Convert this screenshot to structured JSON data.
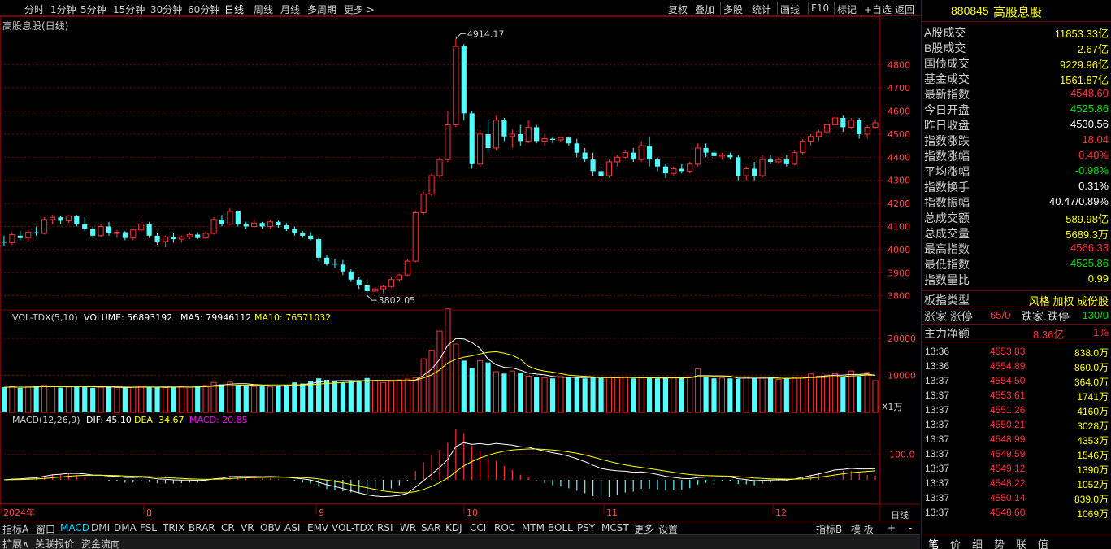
{
  "topbar": {
    "periods": [
      "分时",
      "1分钟",
      "5分钟",
      "15分钟",
      "30分钟",
      "60分钟",
      "日线",
      "周线",
      "月线",
      "多周期",
      "更多 >"
    ],
    "active_period": "日线",
    "tools": [
      "复权",
      "叠加",
      "多股",
      "统计",
      "画线",
      "F10",
      "标记",
      "+自选",
      "返回"
    ]
  },
  "chart": {
    "title": "高股息股(日线)",
    "max_label": "4914.17",
    "min_label": "3802.05",
    "price_axis": [
      "4800",
      "4700",
      "4600",
      "4500",
      "4400",
      "4300",
      "4200",
      "4100",
      "4000",
      "3900",
      "3800"
    ],
    "vol_header": {
      "name": "VOL-TDX(5,10)",
      "volume": "VOLUME: 56893192",
      "ma5": "MA5: 79946112",
      "ma10": "MA10: 76571032"
    },
    "vol_axis": [
      "20000",
      "10000"
    ],
    "vol_unit": "X1万",
    "macd_header": {
      "name": "MACD(12,26,9)",
      "dif": "DIF: 45.10",
      "dea": "DEA: 34.67",
      "macd": "MACD: 20.85"
    },
    "macd_axis": [
      "100.0"
    ],
    "date_labels": [
      "2024年",
      "8",
      "9",
      "10",
      "11",
      "12"
    ],
    "period_label": "日线",
    "colors": {
      "up": "#ff3232",
      "down": "#54ffff",
      "grid": "#7a0000",
      "ma5": "#ffffff",
      "ma10": "#ffff00",
      "dea_color": "#ffff00",
      "macd_color": "#ff00ff"
    }
  },
  "chart_data": {
    "type": "candlestick",
    "ohlc": [
      [
        4035,
        4060,
        4015,
        4030
      ],
      [
        4030,
        4075,
        4020,
        4065
      ],
      [
        4060,
        4080,
        4040,
        4050
      ],
      [
        4050,
        4085,
        4035,
        4075
      ],
      [
        4075,
        4100,
        4060,
        4070
      ],
      [
        4070,
        4140,
        4065,
        4130
      ],
      [
        4130,
        4150,
        4110,
        4140
      ],
      [
        4140,
        4145,
        4110,
        4125
      ],
      [
        4125,
        4150,
        4115,
        4145
      ],
      [
        4145,
        4150,
        4100,
        4110
      ],
      [
        4110,
        4140,
        4080,
        4090
      ],
      [
        4090,
        4100,
        4050,
        4060
      ],
      [
        4060,
        4110,
        4055,
        4100
      ],
      [
        4100,
        4120,
        4060,
        4070
      ],
      [
        4070,
        4085,
        4050,
        4075
      ],
      [
        4075,
        4080,
        4040,
        4050
      ],
      [
        4050,
        4090,
        4040,
        4085
      ],
      [
        4085,
        4130,
        4075,
        4110
      ],
      [
        4110,
        4120,
        4050,
        4060
      ],
      [
        4060,
        4070,
        4020,
        4035
      ],
      [
        4035,
        4060,
        4010,
        4055
      ],
      [
        4055,
        4070,
        4030,
        4045
      ],
      [
        4045,
        4060,
        4030,
        4055
      ],
      [
        4055,
        4075,
        4045,
        4065
      ],
      [
        4065,
        4075,
        4045,
        4050
      ],
      [
        4050,
        4080,
        4045,
        4070
      ],
      [
        4070,
        4140,
        4065,
        4130
      ],
      [
        4130,
        4150,
        4100,
        4110
      ],
      [
        4110,
        4180,
        4105,
        4165
      ],
      [
        4165,
        4170,
        4100,
        4110
      ],
      [
        4110,
        4120,
        4090,
        4100
      ],
      [
        4100,
        4130,
        4095,
        4115
      ],
      [
        4115,
        4120,
        4090,
        4100
      ],
      [
        4100,
        4130,
        4090,
        4120
      ],
      [
        4120,
        4125,
        4095,
        4105
      ],
      [
        4105,
        4115,
        4080,
        4090
      ],
      [
        4090,
        4100,
        4060,
        4070
      ],
      [
        4070,
        4080,
        4050,
        4060
      ],
      [
        4060,
        4075,
        4040,
        4045
      ],
      [
        4045,
        4050,
        3950,
        3965
      ],
      [
        3965,
        3975,
        3930,
        3940
      ],
      [
        3940,
        3960,
        3920,
        3935
      ],
      [
        3935,
        3955,
        3890,
        3905
      ],
      [
        3905,
        3915,
        3860,
        3870
      ],
      [
        3870,
        3880,
        3830,
        3845
      ],
      [
        3845,
        3870,
        3802,
        3820
      ],
      [
        3820,
        3840,
        3805,
        3830
      ],
      [
        3830,
        3845,
        3810,
        3840
      ],
      [
        3840,
        3880,
        3835,
        3870
      ],
      [
        3870,
        3895,
        3860,
        3890
      ],
      [
        3890,
        3960,
        3885,
        3950
      ],
      [
        3950,
        4170,
        3945,
        4160
      ],
      [
        4160,
        4250,
        4150,
        4240
      ],
      [
        4240,
        4330,
        4230,
        4320
      ],
      [
        4320,
        4400,
        4310,
        4390
      ],
      [
        4390,
        4600,
        4380,
        4540
      ],
      [
        4540,
        4914,
        4530,
        4880
      ],
      [
        4880,
        4890,
        4560,
        4590
      ],
      [
        4590,
        4600,
        4350,
        4370
      ],
      [
        4370,
        4520,
        4360,
        4500
      ],
      [
        4500,
        4560,
        4420,
        4440
      ],
      [
        4440,
        4580,
        4430,
        4560
      ],
      [
        4560,
        4570,
        4470,
        4490
      ],
      [
        4490,
        4520,
        4440,
        4500
      ],
      [
        4500,
        4540,
        4450,
        4470
      ],
      [
        4470,
        4560,
        4460,
        4530
      ],
      [
        4530,
        4540,
        4460,
        4470
      ],
      [
        4470,
        4500,
        4450,
        4480
      ],
      [
        4480,
        4490,
        4460,
        4475
      ],
      [
        4475,
        4490,
        4465,
        4485
      ],
      [
        4485,
        4490,
        4450,
        4460
      ],
      [
        4460,
        4480,
        4400,
        4420
      ],
      [
        4420,
        4440,
        4380,
        4390
      ],
      [
        4390,
        4420,
        4320,
        4340
      ],
      [
        4340,
        4370,
        4300,
        4320
      ],
      [
        4320,
        4390,
        4310,
        4380
      ],
      [
        4380,
        4410,
        4360,
        4400
      ],
      [
        4400,
        4430,
        4390,
        4420
      ],
      [
        4420,
        4440,
        4380,
        4390
      ],
      [
        4390,
        4470,
        4380,
        4450
      ],
      [
        4450,
        4490,
        4360,
        4390
      ],
      [
        4390,
        4400,
        4340,
        4360
      ],
      [
        4360,
        4370,
        4310,
        4330
      ],
      [
        4330,
        4360,
        4320,
        4350
      ],
      [
        4350,
        4370,
        4330,
        4340
      ],
      [
        4340,
        4380,
        4330,
        4370
      ],
      [
        4370,
        4460,
        4360,
        4440
      ],
      [
        4440,
        4460,
        4400,
        4420
      ],
      [
        4420,
        4430,
        4400,
        4405
      ],
      [
        4405,
        4420,
        4390,
        4410
      ],
      [
        4410,
        4420,
        4390,
        4400
      ],
      [
        4400,
        4410,
        4300,
        4320
      ],
      [
        4320,
        4360,
        4300,
        4350
      ],
      [
        4350,
        4380,
        4300,
        4320
      ],
      [
        4320,
        4410,
        4310,
        4390
      ],
      [
        4390,
        4410,
        4370,
        4380
      ],
      [
        4380,
        4400,
        4370,
        4390
      ],
      [
        4390,
        4410,
        4360,
        4370
      ],
      [
        4370,
        4430,
        4365,
        4420
      ],
      [
        4420,
        4480,
        4410,
        4470
      ],
      [
        4470,
        4500,
        4450,
        4490
      ],
      [
        4490,
        4520,
        4470,
        4510
      ],
      [
        4510,
        4550,
        4500,
        4540
      ],
      [
        4540,
        4580,
        4530,
        4570
      ],
      [
        4570,
        4580,
        4510,
        4530
      ],
      [
        4530,
        4570,
        4520,
        4560
      ],
      [
        4560,
        4570,
        4480,
        4500
      ],
      [
        4500,
        4540,
        4480,
        4530
      ],
      [
        4530,
        4566,
        4525,
        4549
      ]
    ],
    "volume": [
      6800,
      7000,
      6600,
      6900,
      7100,
      7300,
      7000,
      6700,
      6900,
      7200,
      7000,
      6600,
      6800,
      6900,
      6700,
      6600,
      6800,
      7100,
      6900,
      6800,
      6700,
      6900,
      7000,
      6800,
      7100,
      7300,
      8100,
      7600,
      8200,
      7500,
      7300,
      7000,
      7100,
      6900,
      7200,
      7500,
      8100,
      7800,
      8500,
      9200,
      8800,
      8400,
      8200,
      8500,
      8700,
      9300,
      8600,
      8100,
      8400,
      8800,
      9000,
      9400,
      14500,
      16800,
      22000,
      28000,
      18500,
      14000,
      12000,
      14000,
      13500,
      11000,
      10500,
      11200,
      10800,
      9800,
      9600,
      9400,
      9200,
      9700,
      9500,
      9400,
      9200,
      9600,
      9300,
      9500,
      9400,
      9600,
      9200,
      9400,
      9300,
      9200,
      9500,
      9400,
      9300,
      9600,
      11800,
      9500,
      9200,
      9300,
      9200,
      9100,
      9500,
      9200,
      9300,
      9400,
      8900,
      9200,
      9400,
      9600,
      10400,
      9800,
      10100,
      10500,
      9700,
      11200,
      9800,
      10800,
      8600
    ],
    "title": "高股息股(日线)",
    "max_label": "4914.17",
    "min_label": "3802.05",
    "ylim": [
      3760,
      4940
    ],
    "vol_ylim": [
      0,
      24000
    ]
  },
  "rightpanel": {
    "code": "880845",
    "name": "高股息股",
    "rows": [
      {
        "label": "A股成交",
        "value": "11853.33亿",
        "color": "#ffff00"
      },
      {
        "label": "B股成交",
        "value": "2.67亿",
        "color": "#ffff00"
      },
      {
        "label": "国债成交",
        "value": "9229.96亿",
        "color": "#ffff00"
      },
      {
        "label": "基金成交",
        "value": "1561.87亿",
        "color": "#ffff00"
      },
      {
        "label": "最新指数",
        "value": "4548.60",
        "color": "#ff3232"
      },
      {
        "label": "今日开盘",
        "value": "4525.86",
        "color": "#00e000"
      },
      {
        "label": "昨日收盘",
        "value": "4530.56",
        "color": "#ffffff"
      },
      {
        "label": "指数涨跌",
        "value": "18.04",
        "color": "#ff3232"
      },
      {
        "label": "指数涨幅",
        "value": "0.40%",
        "color": "#ff3232"
      },
      {
        "label": "平均涨幅",
        "value": "-0.98%",
        "color": "#00e000"
      },
      {
        "label": "指数换手",
        "value": "0.31%",
        "color": "#ffffff"
      },
      {
        "label": "指数振幅",
        "value": "40.47/0.89%",
        "color": "#ffffff"
      },
      {
        "label": "总成交额",
        "value": "589.98亿",
        "color": "#ffff00"
      },
      {
        "label": "总成交量",
        "value": "5689.3万",
        "color": "#ffff00"
      },
      {
        "label": "最高指数",
        "value": "4566.33",
        "color": "#ff3232"
      },
      {
        "label": "最低指数",
        "value": "4525.86",
        "color": "#00e000"
      },
      {
        "label": "指数量比",
        "value": "0.99",
        "color": "#ffff00"
      }
    ],
    "type_row": {
      "label": "板指类型",
      "value": "风格 加权 成份股"
    },
    "updown": {
      "up_label": "涨家.涨停",
      "up_value": "65/0",
      "down_label": "跌家.跌停",
      "down_value": "130/0"
    },
    "main_flow": {
      "label": "主力净额",
      "value": "8.36亿",
      "pct": "1%"
    },
    "ticks": [
      {
        "time": "13:36",
        "price": "4553.83",
        "vol": "838.0万"
      },
      {
        "time": "13:36",
        "price": "4554.89",
        "vol": "860.0万"
      },
      {
        "time": "13:37",
        "price": "4554.50",
        "vol": "364.0万"
      },
      {
        "time": "13:37",
        "price": "4553.61",
        "vol": "1741万"
      },
      {
        "time": "13:37",
        "price": "4551.26",
        "vol": "4160万"
      },
      {
        "time": "13:37",
        "price": "4550.21",
        "vol": "3028万"
      },
      {
        "time": "13:37",
        "price": "4548.99",
        "vol": "4353万"
      },
      {
        "time": "13:37",
        "price": "4549.59",
        "vol": "1546万"
      },
      {
        "time": "13:37",
        "price": "4549.12",
        "vol": "1390万"
      },
      {
        "time": "13:37",
        "price": "4548.22",
        "vol": "1052万"
      },
      {
        "time": "13:37",
        "price": "4550.14",
        "vol": "839.0万"
      },
      {
        "time": "13:37",
        "price": "4548.60",
        "vol": "1069万"
      }
    ],
    "bottom_tabs": [
      "笔",
      "价",
      "细",
      "势",
      "联",
      "值"
    ]
  },
  "tabbar": {
    "left": "指标A",
    "tabs": [
      "窗口",
      "MACD",
      "DMI",
      "DMA",
      "FSL",
      "TRIX",
      "BRAR",
      "CR",
      "VR",
      "OBV",
      "ASI",
      "EMV",
      "VOL-TDX",
      "RSI",
      "WR",
      "SAR",
      "KDJ",
      "CCI",
      "ROC",
      "MTM",
      "BOLL",
      "PSY",
      "MCST",
      "更多",
      "设置"
    ],
    "active": "MACD",
    "right": [
      "指标B",
      "模 板",
      "+",
      "-"
    ]
  },
  "bottombar": {
    "items": [
      "扩展∧",
      "关联报价",
      "资金流向"
    ]
  }
}
